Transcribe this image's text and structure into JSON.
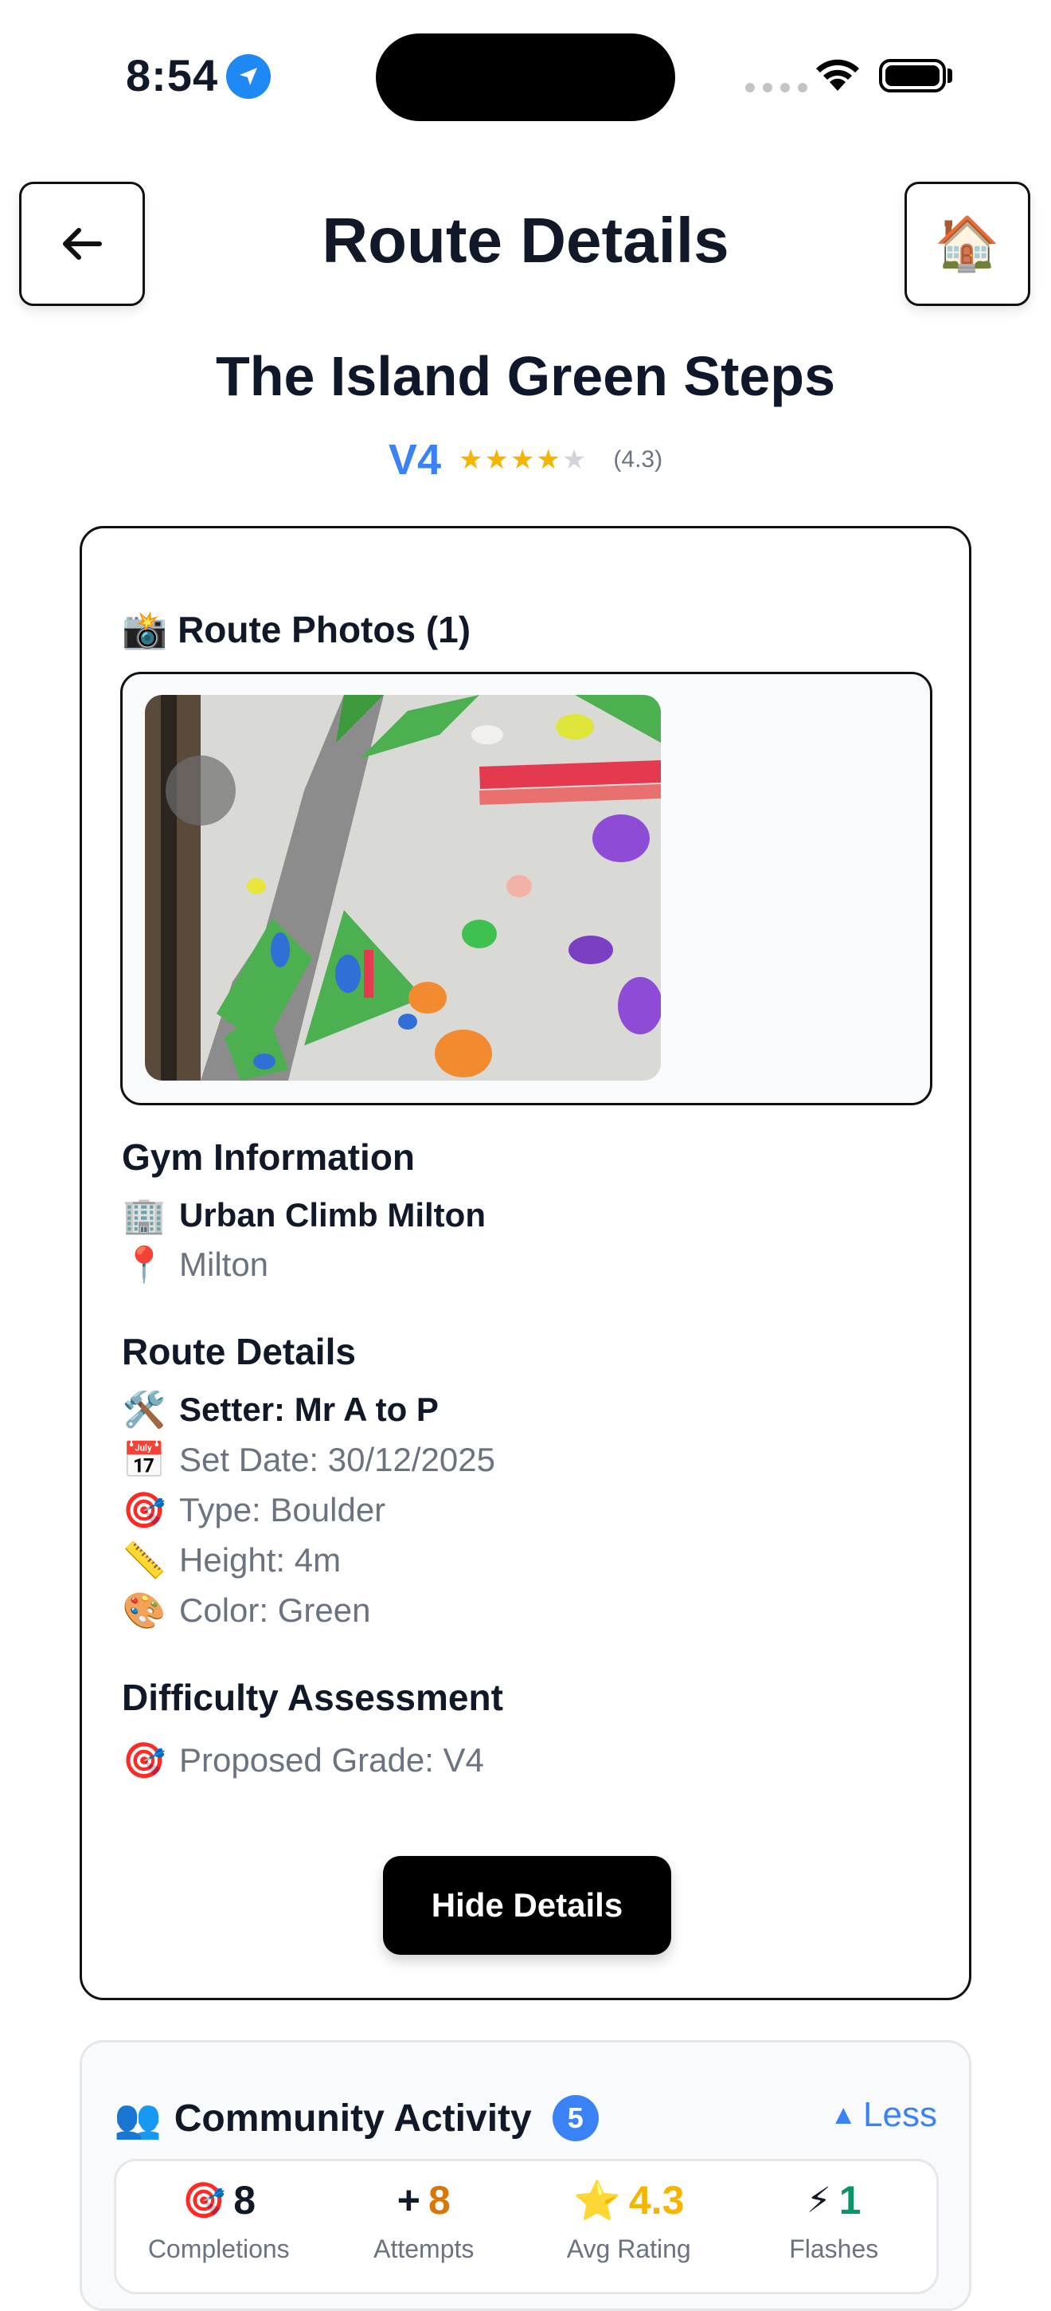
{
  "status_bar": {
    "time": "8:54"
  },
  "header": {
    "title": "Route Details",
    "home_icon": "🏠"
  },
  "route": {
    "name": "The Island Green Steps",
    "grade": "V4",
    "stars": "★★★★",
    "stars_empty": "★",
    "rating": "(4.3)"
  },
  "photos": {
    "heading_icon": "📸",
    "heading": "Route Photos (1)"
  },
  "gym": {
    "title": "Gym Information",
    "name_icon": "🏢",
    "name": "Urban Climb Milton",
    "location_icon": "📍",
    "location": "Milton"
  },
  "details": {
    "title": "Route Details",
    "setter_icon": "🛠️",
    "setter": "Setter: Mr A to P",
    "set_date_icon": "📅",
    "set_date": "Set Date: 30/12/2025",
    "type_icon": "🎯",
    "type": "Type: Boulder",
    "height_icon": "📏",
    "height": "Height: 4m",
    "color_icon": "🎨",
    "color": "Color: Green"
  },
  "difficulty": {
    "title": "Difficulty Assessment",
    "proposed_icon": "🎯",
    "proposed": "Proposed Grade: V4"
  },
  "hide_button": "Hide Details",
  "community": {
    "icon": "👥",
    "title": "Community Activity",
    "count": "5",
    "toggle_icon": "▲",
    "toggle": "Less",
    "stats": [
      {
        "icon": "🎯",
        "value": "8",
        "label": "Completions",
        "color": "#111827"
      },
      {
        "icon": "+",
        "value": "8",
        "label": "Attempts",
        "color": "#d97706"
      },
      {
        "icon": "⭐",
        "value": "4.3",
        "label": "Avg Rating",
        "color": "#f5b400"
      },
      {
        "icon": "⚡",
        "value": "1",
        "label": "Flashes",
        "color": "#059669"
      }
    ]
  },
  "colors": {
    "accent": "#3b82f6",
    "button": "#000000"
  }
}
